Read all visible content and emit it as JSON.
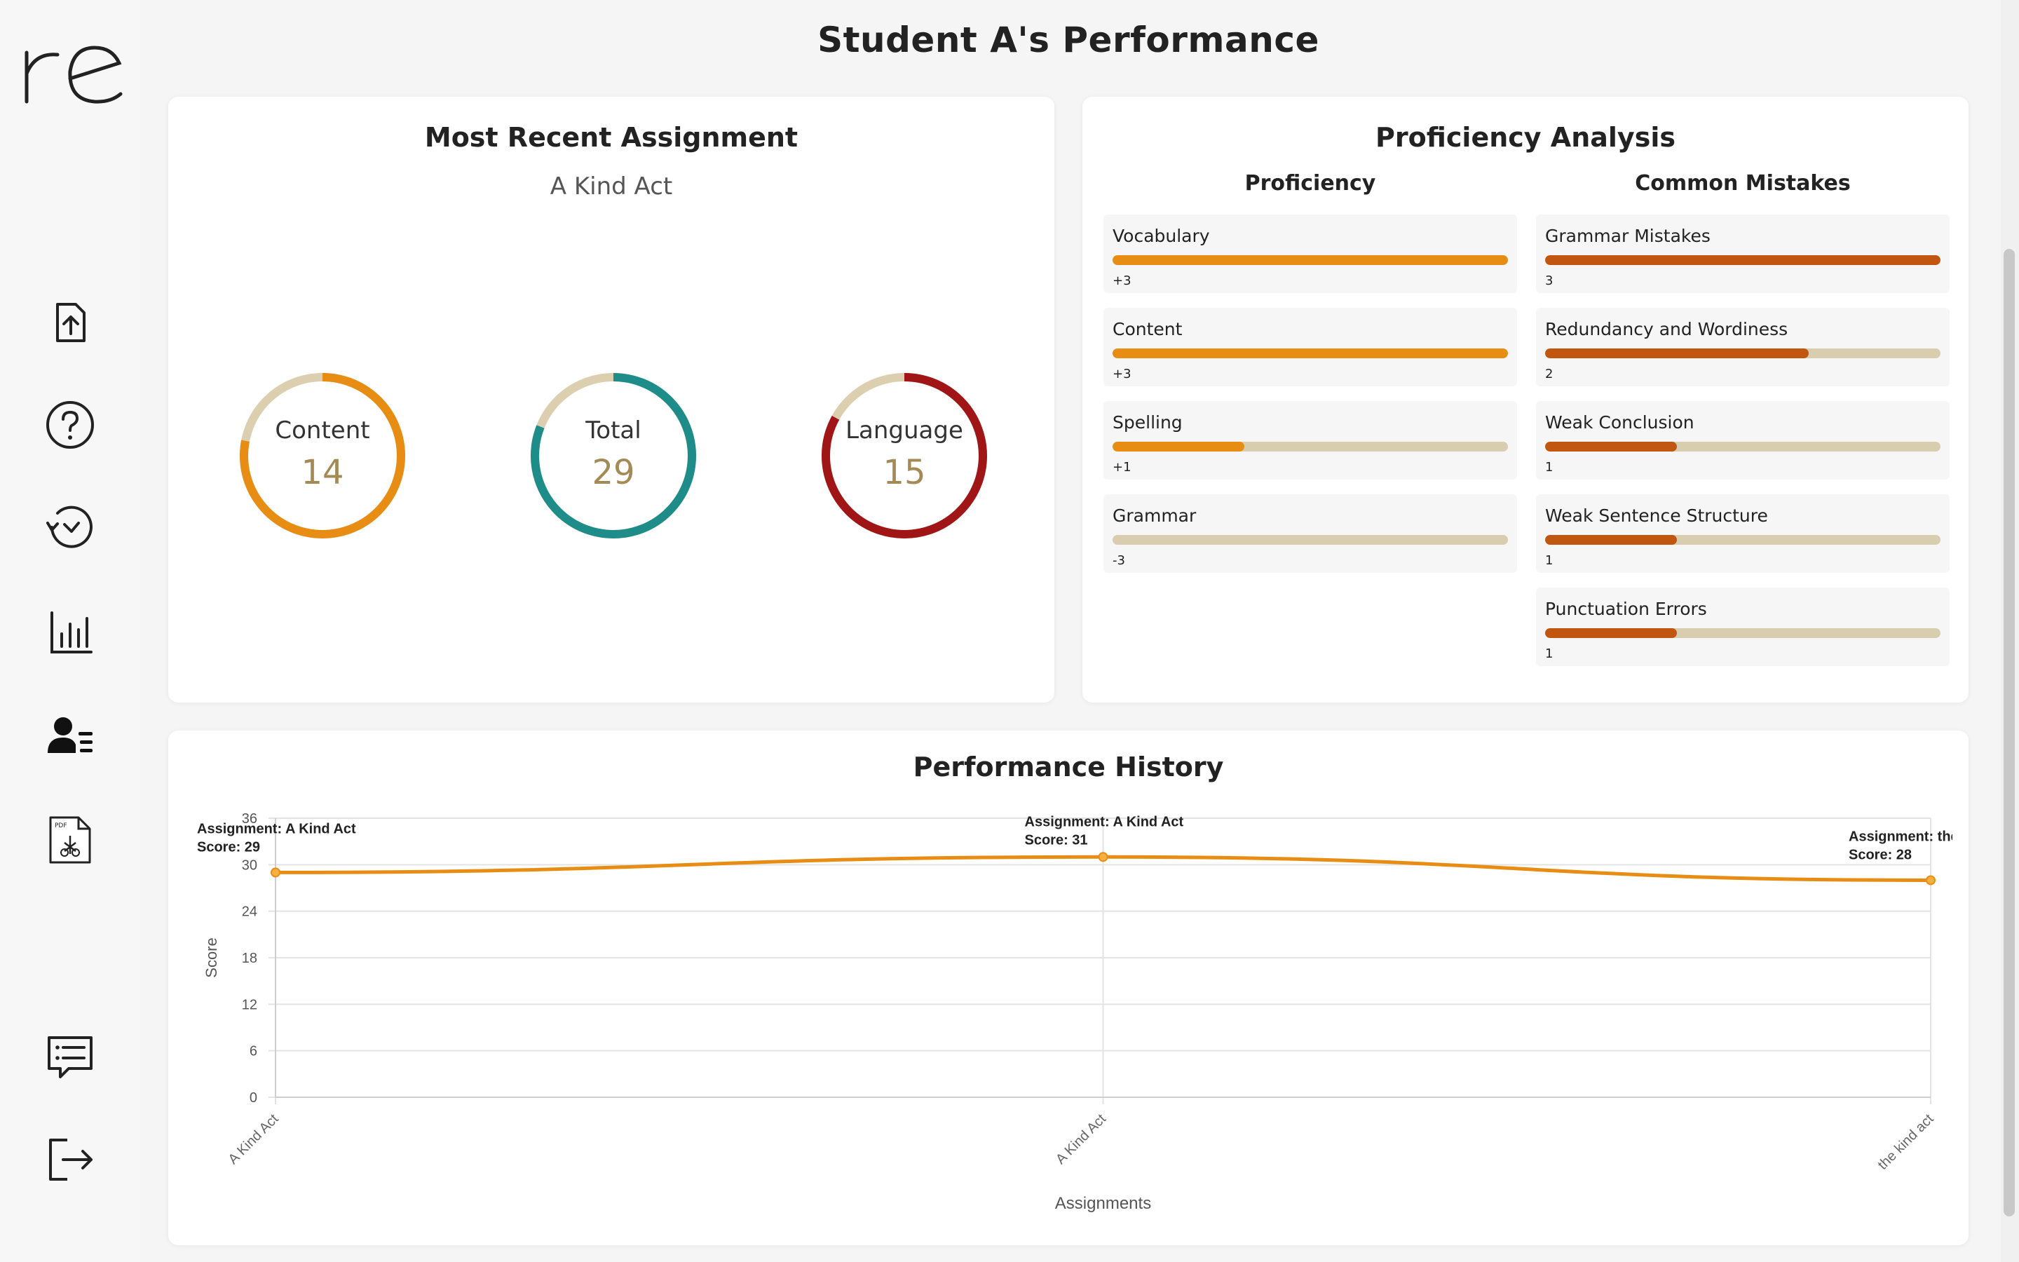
{
  "app": {
    "logo_text": "re"
  },
  "sidebar": {
    "items": [
      {
        "name": "upload",
        "icon": "upload-icon"
      },
      {
        "name": "help",
        "icon": "help-icon"
      },
      {
        "name": "history",
        "icon": "history-icon"
      },
      {
        "name": "stats",
        "icon": "bar-chart-icon"
      },
      {
        "name": "students",
        "icon": "user-list-icon"
      },
      {
        "name": "pdf",
        "icon": "pdf-file-icon"
      },
      {
        "name": "feedback",
        "icon": "message-list-icon"
      },
      {
        "name": "logout",
        "icon": "logout-icon"
      }
    ]
  },
  "page": {
    "title": "Student A's Performance"
  },
  "recent": {
    "title": "Most Recent Assignment",
    "assignment": "A Kind Act",
    "scores": [
      {
        "label": "Content",
        "value": "14",
        "fraction": 0.78,
        "color": "#e88d14"
      },
      {
        "label": "Total",
        "value": "29",
        "fraction": 0.81,
        "color": "#1e8c88"
      },
      {
        "label": "Language",
        "value": "15",
        "fraction": 0.83,
        "color": "#a01515"
      }
    ],
    "track_color": "#dccfb0"
  },
  "proficiency": {
    "title": "Proficiency Analysis",
    "proficiency_heading": "Proficiency",
    "mistakes_heading": "Common Mistakes",
    "proficiency_color": "#e88d14",
    "mistake_color": "#c0560f",
    "items": [
      {
        "name": "Vocabulary",
        "value": "+3",
        "fraction": 1.0
      },
      {
        "name": "Content",
        "value": "+3",
        "fraction": 1.0
      },
      {
        "name": "Spelling",
        "value": "+1",
        "fraction": 0.333
      },
      {
        "name": "Grammar",
        "value": "-3",
        "fraction": 0.0
      }
    ],
    "mistakes": [
      {
        "name": "Grammar Mistakes",
        "value": "3",
        "fraction": 1.0
      },
      {
        "name": "Redundancy and Wordiness",
        "value": "2",
        "fraction": 0.667
      },
      {
        "name": "Weak Conclusion",
        "value": "1",
        "fraction": 0.333
      },
      {
        "name": "Weak Sentence Structure",
        "value": "1",
        "fraction": 0.333
      },
      {
        "name": "Punctuation Errors",
        "value": "1",
        "fraction": 0.333
      }
    ]
  },
  "history": {
    "title": "Performance History"
  },
  "chart_data": {
    "type": "line",
    "categories": [
      "A Kind Act",
      "A Kind Act",
      "the kind act"
    ],
    "series": [
      {
        "values": [
          29,
          31,
          28
        ],
        "color": "#e88d14"
      }
    ],
    "annotations": [
      {
        "line1": "Assignment: A Kind Act",
        "line2": "Score: 29"
      },
      {
        "line1": "Assignment: A Kind Act",
        "line2": "Score: 31"
      },
      {
        "line1": "Assignment: the kind act",
        "line2": "Score: 28"
      }
    ],
    "xlabel": "Assignments",
    "ylabel": "Score",
    "ylim": [
      0,
      36
    ],
    "yticks": [
      0,
      6,
      12,
      18,
      24,
      30,
      36
    ],
    "grid": true
  }
}
